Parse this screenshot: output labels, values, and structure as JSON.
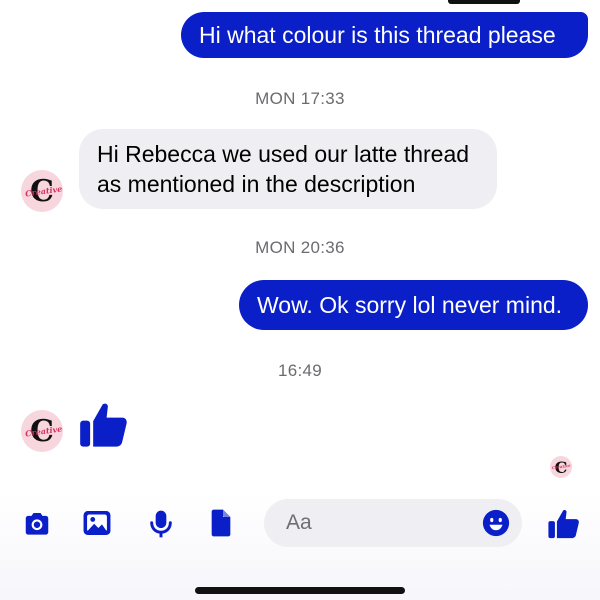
{
  "theme": {
    "accent": "#0a1fc8",
    "incoming_bg": "#EFEFF3",
    "timestamp_color": "#6b6b70",
    "avatar_bg": "#F8D6DE"
  },
  "conversation": {
    "messages": [
      {
        "direction": "outgoing",
        "text": "Hi what colour is this thread please"
      },
      {
        "type": "timestamp",
        "text": "MON 17:33"
      },
      {
        "direction": "incoming",
        "text": "Hi Rebecca we used our latte thread\nas mentioned in the description"
      },
      {
        "type": "timestamp",
        "text": "MON 20:36"
      },
      {
        "direction": "outgoing",
        "text": "Wow. Ok sorry lol never mind."
      },
      {
        "type": "timestamp",
        "text": "16:49"
      },
      {
        "direction": "incoming",
        "type": "sticker",
        "icon": "thumbs-up-icon"
      }
    ],
    "contact_avatar": {
      "letter": "C",
      "word": "Creative"
    },
    "read_receipt": {
      "letter": "C",
      "word": "Creative"
    }
  },
  "composer": {
    "placeholder": "Aa",
    "actions": [
      "camera-icon",
      "gallery-icon",
      "microphone-icon",
      "file-icon"
    ],
    "emoji_icon": "smiley-icon",
    "send_icon": "thumbs-up-icon"
  }
}
